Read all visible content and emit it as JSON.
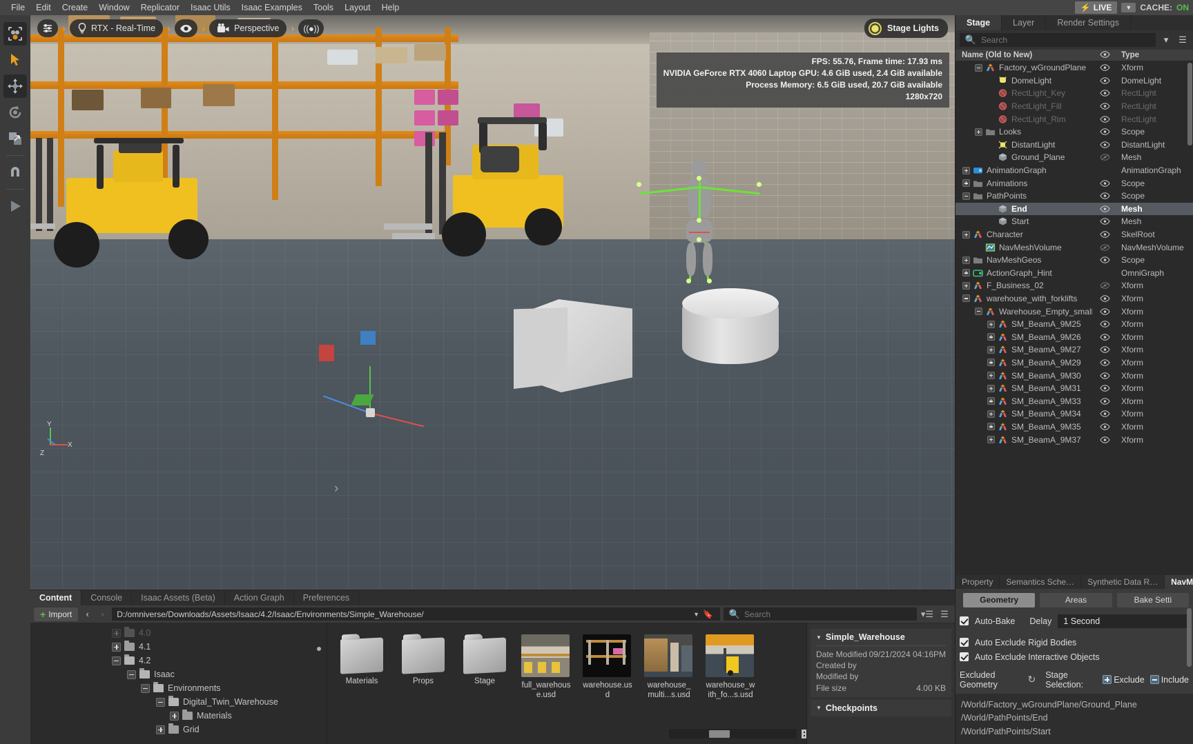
{
  "menubar": {
    "items": [
      "File",
      "Edit",
      "Create",
      "Window",
      "Replicator",
      "Isaac Utils",
      "Isaac Examples",
      "Tools",
      "Layout",
      "Help"
    ],
    "live_label": "LIVE",
    "cache_label": "CACHE:",
    "cache_value": "ON"
  },
  "toolstrip": {
    "items": [
      {
        "name": "select-mode-tool",
        "title": "Select"
      },
      {
        "name": "cursor-tool",
        "title": "Cursor"
      },
      {
        "name": "move-tool",
        "title": "Move"
      },
      {
        "name": "rotate-tool",
        "title": "Rotate"
      },
      {
        "name": "scale-tool",
        "title": "Scale"
      },
      {
        "name": "snap-tool",
        "title": "Snap"
      },
      {
        "name": "play-tool",
        "title": "Play"
      }
    ]
  },
  "viewport": {
    "settings_icon": "sliders-icon",
    "renderer_label": "RTX - Real-Time",
    "renderer_icon": "lightbulb-icon",
    "eye_icon": "eye-icon",
    "camera_label": "Perspective",
    "camera_icon": "camera-icon",
    "chevron": "›",
    "broadcast_icon": "((●))",
    "stage_lights_label": "Stage Lights",
    "hud": {
      "line1": "FPS: 55.76, Frame time: 17.93 ms",
      "line2": "NVIDIA GeForce RTX 4060 Laptop GPU: 4.6 GiB used, 2.4 GiB available",
      "line3": "Process Memory: 6.5 GiB used, 20.7 GiB available",
      "line4": "1280x720"
    }
  },
  "right_dock": {
    "tabs": [
      {
        "label": "Stage",
        "active": true
      },
      {
        "label": "Layer",
        "active": false
      },
      {
        "label": "Render Settings",
        "active": false
      }
    ],
    "search_placeholder": "Search",
    "filter_icon": "filter-icon",
    "menu_icon": "hamburger-icon",
    "columns": {
      "name": "Name (Old to New)",
      "eye": "eye-icon",
      "type": "Type"
    },
    "tree": [
      {
        "label": "Factory_wGroundPlane",
        "type": "Xform",
        "indent": 1,
        "exp": "minus",
        "icon": "xform",
        "vis": "on",
        "dim": false,
        "selected": false
      },
      {
        "label": "DomeLight",
        "type": "DomeLight",
        "indent": 2,
        "exp": "none",
        "icon": "domelight",
        "vis": "on",
        "dim": false,
        "selected": false
      },
      {
        "label": "RectLight_Key",
        "type": "RectLight",
        "indent": 2,
        "exp": "none",
        "icon": "disabled",
        "vis": "off",
        "dim": true,
        "selected": false
      },
      {
        "label": "RectLight_Fill",
        "type": "RectLight",
        "indent": 2,
        "exp": "none",
        "icon": "disabled",
        "vis": "off",
        "dim": true,
        "selected": false
      },
      {
        "label": "RectLight_Rim",
        "type": "RectLight",
        "indent": 2,
        "exp": "none",
        "icon": "disabled",
        "vis": "off",
        "dim": true,
        "selected": false
      },
      {
        "label": "Looks",
        "type": "Scope",
        "indent": 1,
        "exp": "plus",
        "icon": "folder",
        "vis": "on",
        "dim": false,
        "selected": false
      },
      {
        "label": "DistantLight",
        "type": "DistantLight",
        "indent": 2,
        "exp": "none",
        "icon": "distantlight",
        "vis": "on",
        "dim": false,
        "selected": false
      },
      {
        "label": "Ground_Plane",
        "type": "Mesh",
        "indent": 2,
        "exp": "none",
        "icon": "mesh",
        "vis": "hidden",
        "dim": false,
        "selected": false
      },
      {
        "label": "AnimationGraph",
        "type": "AnimationGraph",
        "indent": 0,
        "exp": "plus",
        "icon": "animgraph",
        "vis": "none",
        "dim": false,
        "selected": false
      },
      {
        "label": "Animations",
        "type": "Scope",
        "indent": 0,
        "exp": "plus",
        "icon": "folder",
        "vis": "on",
        "dim": false,
        "selected": false
      },
      {
        "label": "PathPoints",
        "type": "Scope",
        "indent": 0,
        "exp": "minus",
        "icon": "folder",
        "vis": "on",
        "dim": false,
        "selected": false
      },
      {
        "label": "End",
        "type": "Mesh",
        "indent": 2,
        "exp": "none",
        "icon": "mesh",
        "vis": "on",
        "dim": false,
        "selected": true
      },
      {
        "label": "Start",
        "type": "Mesh",
        "indent": 2,
        "exp": "none",
        "icon": "mesh",
        "vis": "on",
        "dim": false,
        "selected": false
      },
      {
        "label": "Character",
        "type": "SkelRoot",
        "indent": 0,
        "exp": "plus",
        "icon": "xform",
        "vis": "on",
        "dim": false,
        "selected": false
      },
      {
        "label": "NavMeshVolume",
        "type": "NavMeshVolume",
        "indent": 1,
        "exp": "none",
        "icon": "navmesh",
        "vis": "hidden",
        "dim": false,
        "selected": false
      },
      {
        "label": "NavMeshGeos",
        "type": "Scope",
        "indent": 0,
        "exp": "plus",
        "icon": "folder",
        "vis": "on",
        "dim": false,
        "selected": false
      },
      {
        "label": "ActionGraph_Hint",
        "type": "OmniGraph",
        "indent": 0,
        "exp": "plus",
        "icon": "omnigraph",
        "vis": "none",
        "dim": false,
        "selected": false
      },
      {
        "label": "F_Business_02",
        "type": "Xform",
        "indent": 0,
        "exp": "plus",
        "icon": "xform",
        "vis": "hidden",
        "dim": false,
        "selected": false
      },
      {
        "label": "warehouse_with_forklifts",
        "type": "Xform",
        "indent": 0,
        "exp": "minus",
        "icon": "xform",
        "vis": "on",
        "dim": false,
        "selected": false
      },
      {
        "label": "Warehouse_Empty_small_re…",
        "type": "Xform",
        "indent": 1,
        "exp": "minus",
        "icon": "xform",
        "vis": "on",
        "dim": false,
        "selected": false
      },
      {
        "label": "SM_BeamA_9M25",
        "type": "Xform",
        "indent": 2,
        "exp": "plus",
        "icon": "xform",
        "vis": "on",
        "dim": false,
        "selected": false
      },
      {
        "label": "SM_BeamA_9M26",
        "type": "Xform",
        "indent": 2,
        "exp": "plus",
        "icon": "xform",
        "vis": "on",
        "dim": false,
        "selected": false
      },
      {
        "label": "SM_BeamA_9M27",
        "type": "Xform",
        "indent": 2,
        "exp": "plus",
        "icon": "xform",
        "vis": "on",
        "dim": false,
        "selected": false
      },
      {
        "label": "SM_BeamA_9M29",
        "type": "Xform",
        "indent": 2,
        "exp": "plus",
        "icon": "xform",
        "vis": "on",
        "dim": false,
        "selected": false
      },
      {
        "label": "SM_BeamA_9M30",
        "type": "Xform",
        "indent": 2,
        "exp": "plus",
        "icon": "xform",
        "vis": "on",
        "dim": false,
        "selected": false
      },
      {
        "label": "SM_BeamA_9M31",
        "type": "Xform",
        "indent": 2,
        "exp": "plus",
        "icon": "xform",
        "vis": "on",
        "dim": false,
        "selected": false
      },
      {
        "label": "SM_BeamA_9M33",
        "type": "Xform",
        "indent": 2,
        "exp": "plus",
        "icon": "xform",
        "vis": "on",
        "dim": false,
        "selected": false
      },
      {
        "label": "SM_BeamA_9M34",
        "type": "Xform",
        "indent": 2,
        "exp": "plus",
        "icon": "xform",
        "vis": "on",
        "dim": false,
        "selected": false
      },
      {
        "label": "SM_BeamA_9M35",
        "type": "Xform",
        "indent": 2,
        "exp": "plus",
        "icon": "xform",
        "vis": "on",
        "dim": false,
        "selected": false
      },
      {
        "label": "SM_BeamA_9M37",
        "type": "Xform",
        "indent": 2,
        "exp": "plus",
        "icon": "xform",
        "vis": "on",
        "dim": false,
        "selected": false
      }
    ]
  },
  "property_panel": {
    "tabs": [
      {
        "label": "Property",
        "active": false
      },
      {
        "label": "Semantics Sche…",
        "active": false
      },
      {
        "label": "Synthetic Data R…",
        "active": false
      },
      {
        "label": "NavMesh",
        "active": true
      }
    ],
    "segments": [
      {
        "label": "Geometry",
        "active": true
      },
      {
        "label": "Areas",
        "active": false
      },
      {
        "label": "Bake Setti",
        "active": false
      }
    ],
    "auto_bake_label": "Auto-Bake",
    "delay_label": "Delay",
    "delay_value": "1 Second",
    "auto_exclude_rigid_label": "Auto Exclude Rigid Bodies",
    "auto_exclude_interactive_label": "Auto  Exclude Interactive Objects",
    "excluded_geometry_label": "Excluded Geometry",
    "refresh_icon": "refresh-icon",
    "stage_selection_label": "Stage Selection:",
    "exclude_button": "Exclude",
    "include_button": "Include",
    "excluded_items": [
      "/World/Factory_wGroundPlane/Ground_Plane",
      "/World/PathPoints/End",
      "/World/PathPoints/Start"
    ]
  },
  "bottom_dock": {
    "tabs": [
      {
        "label": "Content",
        "active": true
      },
      {
        "label": "Console",
        "active": false
      },
      {
        "label": "Isaac Assets (Beta)",
        "active": false
      },
      {
        "label": "Action Graph",
        "active": false
      },
      {
        "label": "Preferences",
        "active": false
      }
    ],
    "import_label": "Import",
    "back_arrow": "‹",
    "forward_arrow": "›",
    "path_value": "D:/omniverse/Downloads/Assets/Isaac/4.2/Isaac/Environments/Simple_Warehouse/",
    "bookmark_icon": "bookmark-icon",
    "search_placeholder": "Search",
    "search_icon": "search-icon",
    "filter_icon": "filter-icon",
    "options_icon": "hamburger-icon",
    "folder_tree": [
      {
        "label": "4.0",
        "indent": 2,
        "exp": "plus",
        "open": false,
        "partial": true
      },
      {
        "label": "4.1",
        "indent": 2,
        "exp": "plus",
        "open": false,
        "partial": false
      },
      {
        "label": "4.2",
        "indent": 2,
        "exp": "minus",
        "open": true,
        "partial": false
      },
      {
        "label": "Isaac",
        "indent": 3,
        "exp": "minus",
        "open": true,
        "partial": false
      },
      {
        "label": "Environments",
        "indent": 4,
        "exp": "minus",
        "open": true,
        "partial": false
      },
      {
        "label": "Digital_Twin_Warehouse",
        "indent": 5,
        "exp": "minus",
        "open": true,
        "partial": false
      },
      {
        "label": "Materials",
        "indent": 6,
        "exp": "plus",
        "open": false,
        "partial": false
      },
      {
        "label": "Grid",
        "indent": 5,
        "exp": "plus",
        "open": false,
        "partial": false
      }
    ],
    "assets": [
      {
        "label": "Materials",
        "kind": "folder"
      },
      {
        "label": "Props",
        "kind": "folder"
      },
      {
        "label": "Stage",
        "kind": "folder"
      },
      {
        "label": "full_warehouse.usd",
        "kind": "usd",
        "thumb": "warehouse-aisle"
      },
      {
        "label": "warehouse.usd",
        "kind": "usd",
        "thumb": "warehouse-racks-dark"
      },
      {
        "label": "warehouse_multi...s.usd",
        "kind": "usd",
        "thumb": "warehouse-shelves"
      },
      {
        "label": "warehouse_with_fo...s.usd",
        "kind": "usd",
        "thumb": "warehouse-forklift"
      }
    ],
    "detail": {
      "title": "Simple_Warehouse",
      "rows": [
        {
          "key": "Date Modified",
          "val": "09/21/2024 04:16PM"
        },
        {
          "key": "Created by",
          "val": ""
        },
        {
          "key": "Modified by",
          "val": ""
        },
        {
          "key": "File size",
          "val": "4.00 KB"
        }
      ],
      "checkpoints_title": "Checkpoints"
    }
  },
  "colors": {
    "accent_orange": "#e08c1c",
    "live_yellow": "#d8e62a",
    "cache_green": "#55c04a",
    "selection_blue": "#555b60",
    "skeleton_green": "#6de23a"
  }
}
